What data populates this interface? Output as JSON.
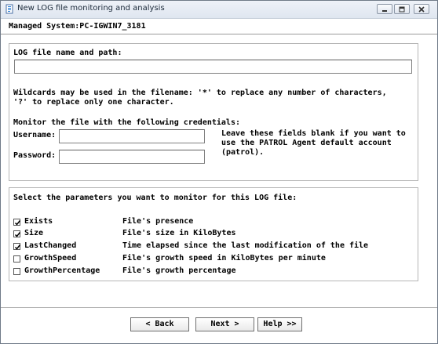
{
  "window": {
    "title": "New LOG file monitoring and analysis",
    "minimize_icon": "minimize-icon",
    "restore_icon": "restore-icon",
    "close_icon": "close-icon"
  },
  "header": {
    "managed_system": "Managed System:PC-IGWIN7_3181"
  },
  "file_section": {
    "path_label": "LOG file name and path:",
    "path_value": "",
    "wildcard_line1": "Wildcards may be used in the filename: '*' to replace any number of characters,",
    "wildcard_line2": "'?' to replace only one character.",
    "credentials_label": "Monitor the file with the following credentials:",
    "username_label": "Username:",
    "username_value": "",
    "password_label": "Password:",
    "password_value": "",
    "hint_line1": "Leave these fields blank if you want to",
    "hint_line2": "use the PATROL Agent default account",
    "hint_line3": "(patrol)."
  },
  "params_section": {
    "heading": "Select the parameters you want to monitor for this LOG file:",
    "params": [
      {
        "name": "Exists",
        "description": "File's presence",
        "checked": true
      },
      {
        "name": "Size",
        "description": "File's size in KiloBytes",
        "checked": true
      },
      {
        "name": "LastChanged",
        "description": "Time elapsed since the last modification of the file",
        "checked": true
      },
      {
        "name": "GrowthSpeed",
        "description": "File's growth speed in KiloBytes per minute",
        "checked": false
      },
      {
        "name": "GrowthPercentage",
        "description": "File's growth percentage",
        "checked": false
      }
    ]
  },
  "buttons": {
    "back": "< Back",
    "next": "Next >",
    "help": "Help >>"
  }
}
